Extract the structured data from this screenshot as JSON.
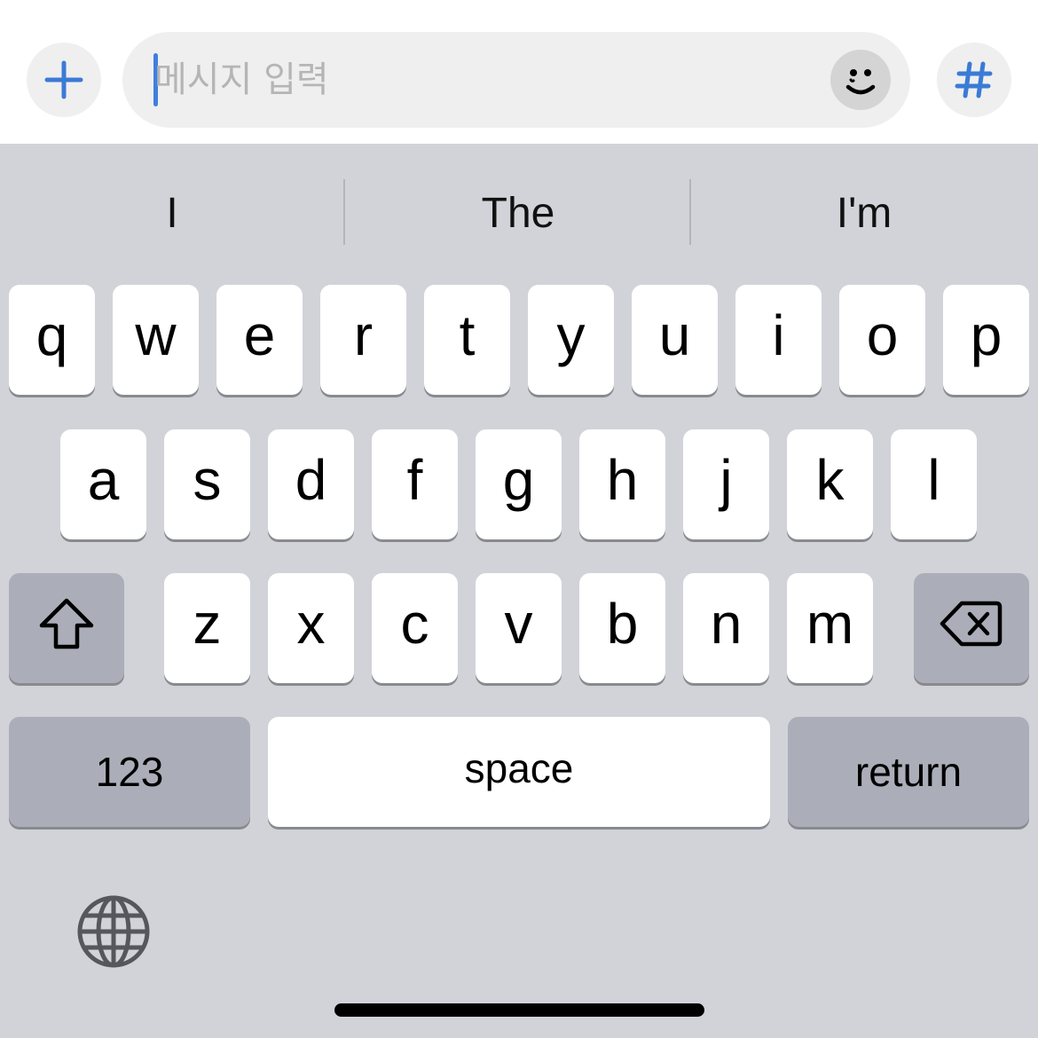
{
  "input_bar": {
    "placeholder": "메시지 입력",
    "value": "",
    "plus_icon": "plus-icon",
    "emoji_icon": "smiley-icon",
    "hash_icon": "hashtag-icon",
    "accent_color": "#3a7bd5"
  },
  "predictive": {
    "suggestions": [
      "I",
      "The",
      "I'm"
    ]
  },
  "keyboard": {
    "row1": [
      "q",
      "w",
      "e",
      "r",
      "t",
      "y",
      "u",
      "i",
      "o",
      "p"
    ],
    "row2": [
      "a",
      "s",
      "d",
      "f",
      "g",
      "h",
      "j",
      "k",
      "l"
    ],
    "row3": [
      "z",
      "x",
      "c",
      "v",
      "b",
      "n",
      "m"
    ],
    "shift_icon": "shift-icon",
    "delete_icon": "delete-icon",
    "numbers_label": "123",
    "space_label": "space",
    "return_label": "return",
    "globe_icon": "globe-icon"
  }
}
